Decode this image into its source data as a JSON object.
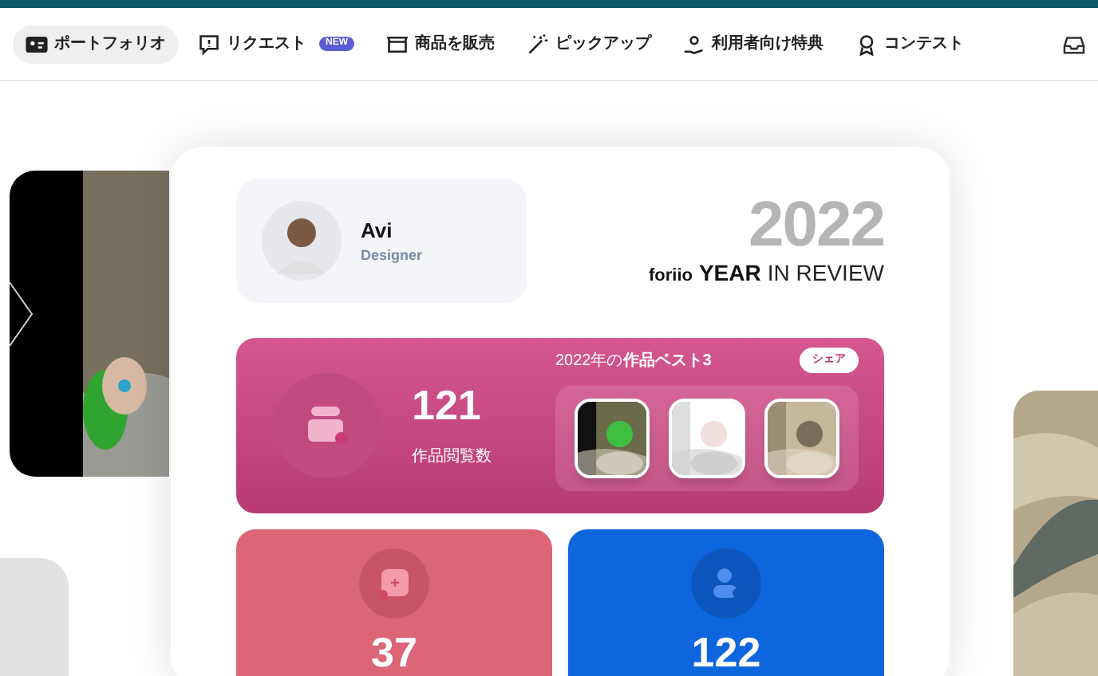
{
  "nav": {
    "items": [
      {
        "label": "ポートフォリオ",
        "kind": "portfolio",
        "selected": true
      },
      {
        "label": "リクエスト",
        "kind": "request",
        "selected": false,
        "badge": "NEW"
      },
      {
        "label": "商品を販売",
        "kind": "shop",
        "selected": false
      },
      {
        "label": "ピックアップ",
        "kind": "pickup",
        "selected": false
      },
      {
        "label": "利用者向け特典",
        "kind": "perks",
        "selected": false
      },
      {
        "label": "コンテスト",
        "kind": "contest",
        "selected": false
      }
    ]
  },
  "hero": {
    "profile": {
      "name": "Avi",
      "role": "Designer"
    },
    "review": {
      "brand": "foriio",
      "year_word": "YEAR",
      "rest": "IN REVIEW",
      "big_year": "2022"
    },
    "views": {
      "value": "121",
      "label": "作品閲覧数",
      "best_title": "2022年の**作品ベスト3**",
      "share": "シェア"
    },
    "stats": [
      {
        "value": "37",
        "kind": "works"
      },
      {
        "value": "122",
        "kind": "followers"
      }
    ]
  }
}
